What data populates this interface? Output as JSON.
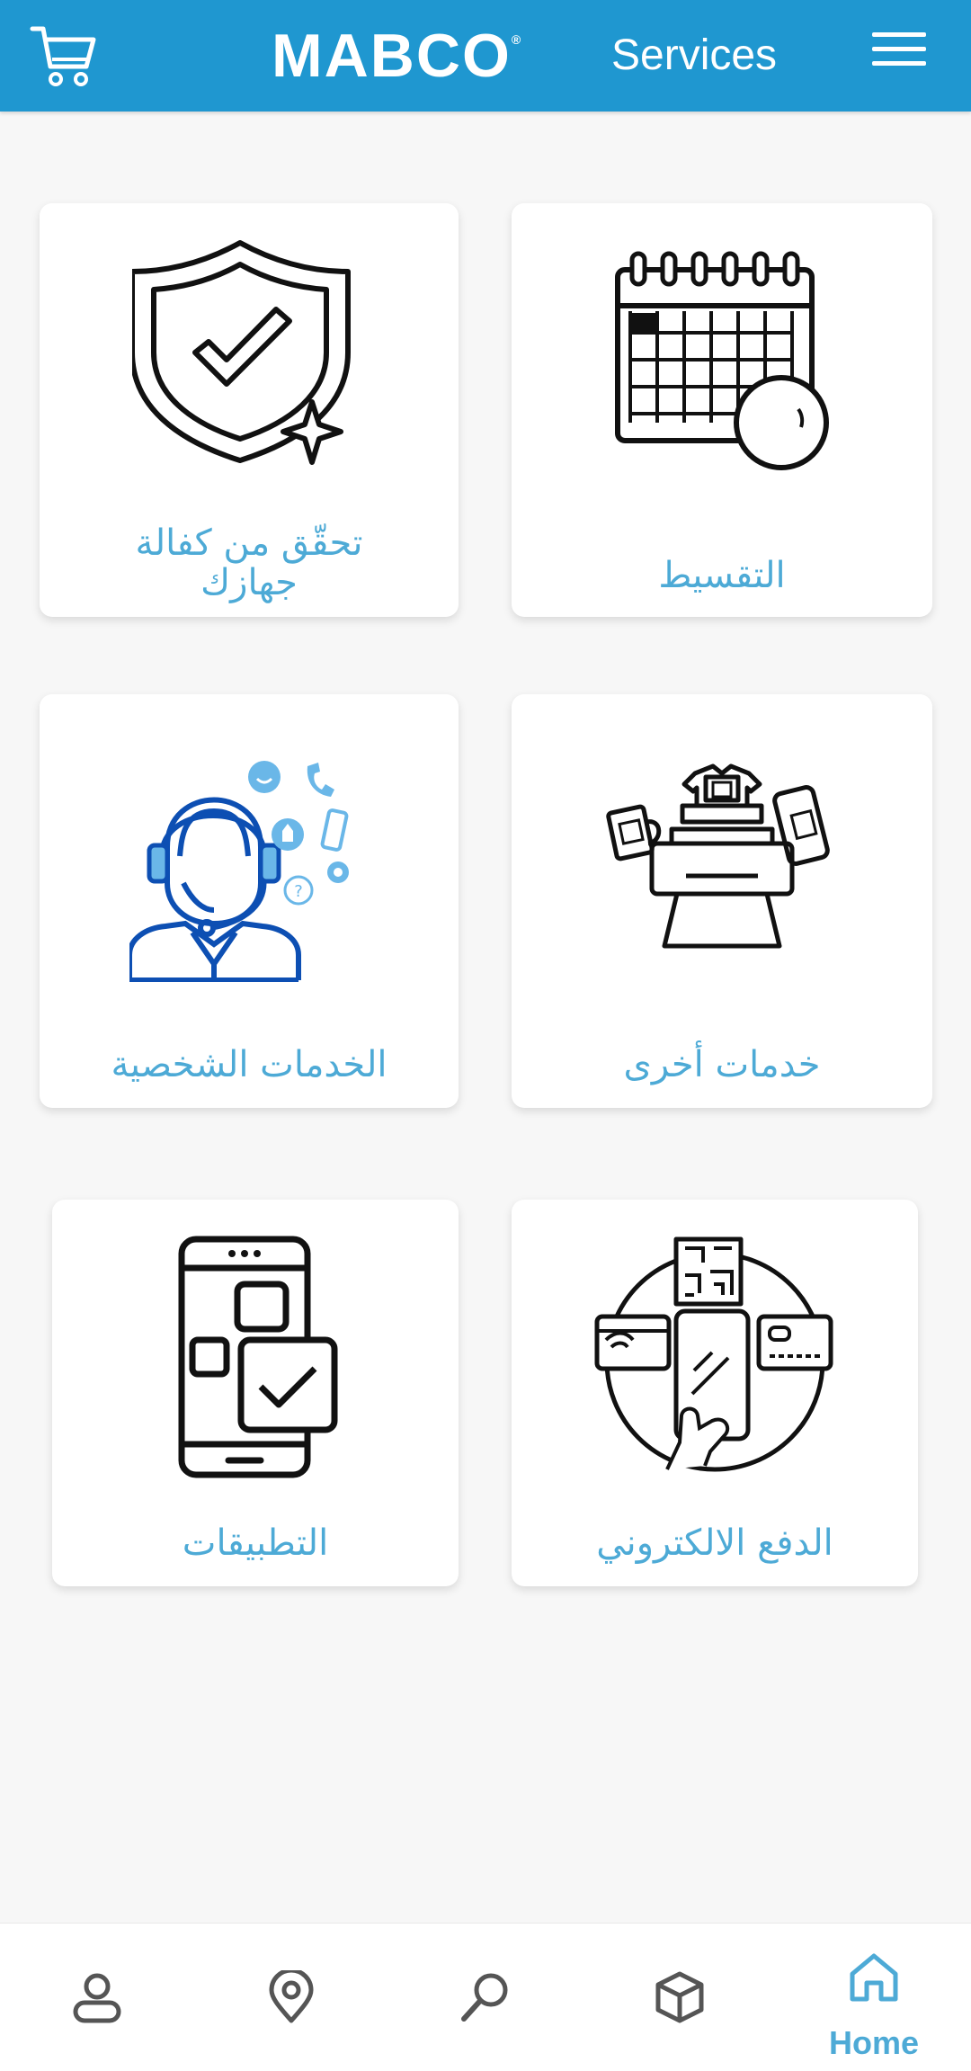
{
  "header": {
    "cart_icon": "cart-icon",
    "logo": "MABCO",
    "logo_mark": "®",
    "title": "Services",
    "menu_icon": "hamburger-menu-icon",
    "background_color": "#1f97d0"
  },
  "services": [
    {
      "label": "تحقّق من كفالة جهازك",
      "icon": "shield-check-icon"
    },
    {
      "label": "التقسيط",
      "icon": "calendar-icon"
    },
    {
      "label": "الخدمات الشخصية",
      "icon": "customer-support-icon"
    },
    {
      "label": "خدمات أخرى",
      "icon": "printing-services-icon"
    },
    {
      "label": "التطبيقات",
      "icon": "mobile-apps-icon"
    },
    {
      "label": "الدفع الالكتروني",
      "icon": "electronic-payment-icon"
    }
  ],
  "bottom_nav": {
    "items": [
      {
        "icon": "profile-icon"
      },
      {
        "icon": "location-pin-icon"
      },
      {
        "icon": "search-icon"
      },
      {
        "icon": "box-icon"
      },
      {
        "icon": "home-icon",
        "label": "Home",
        "active": true
      }
    ],
    "accent_color": "#4daad6"
  },
  "label_color": "#4daad6"
}
